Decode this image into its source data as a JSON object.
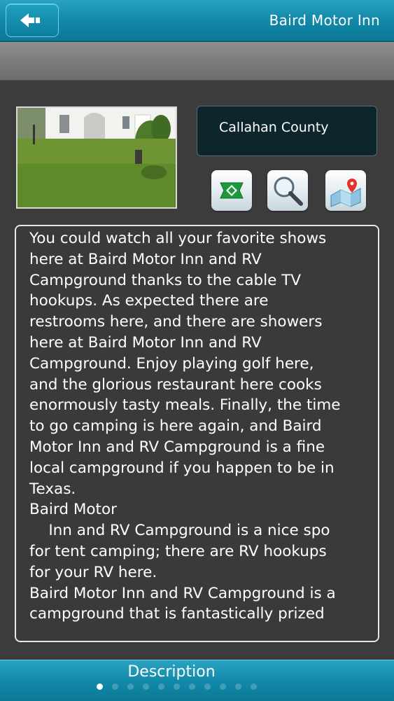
{
  "header": {
    "title": "Baird Motor Inn",
    "back_icon": "back-arrow-icon"
  },
  "location": {
    "county": "Callahan County"
  },
  "actions": [
    {
      "name": "directions-sign-icon"
    },
    {
      "name": "magnifier-icon"
    },
    {
      "name": "map-pin-icon"
    }
  ],
  "description": {
    "lines": [
      "You could watch all your favorite shows",
      "here at Baird Motor Inn and RV",
      "Campground thanks to the cable TV",
      "hookups. As expected there are",
      "restrooms here, and there are showers",
      "here at Baird Motor Inn and RV",
      "Campground. Enjoy playing golf here,",
      "and the glorious restaurant here cooks",
      "enormously tasty meals. Finally, the time",
      "to go camping is here again, and Baird",
      "Motor Inn and RV Campground is a fine",
      "local campground if you happen to be in",
      "Texas.",
      "Baird Motor",
      "    Inn and RV Campground is a nice spo",
      "for tent camping; there are RV hookups",
      "for your RV here.",
      "Baird Motor Inn and RV Campground is a",
      "campground that is fantastically prized"
    ]
  },
  "footer": {
    "label": "Description",
    "page_count": 11,
    "active_page": 1
  },
  "colors": {
    "accent": "#138aaa",
    "background": "#3c3c3c",
    "county_box": "#0d252c"
  }
}
